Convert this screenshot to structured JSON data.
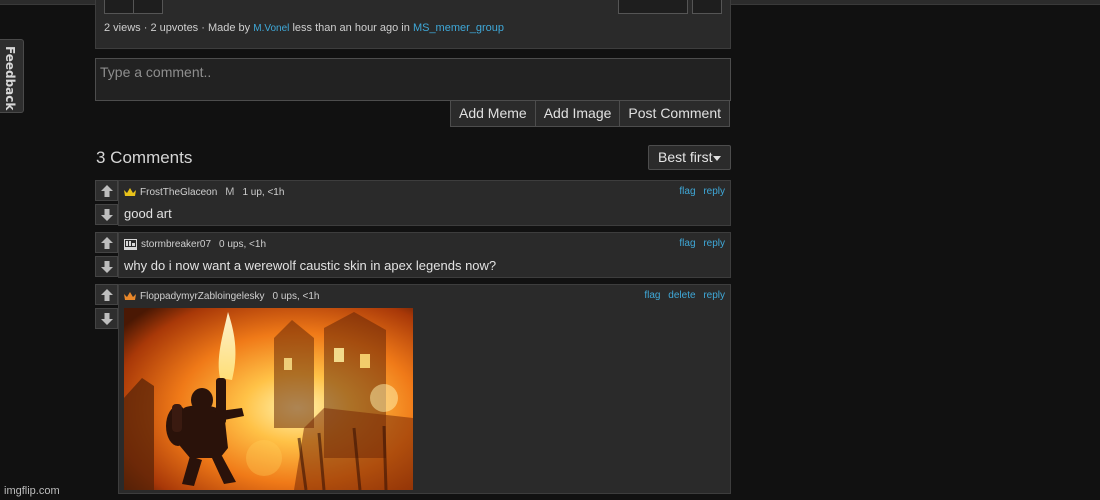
{
  "feedback": {
    "label": "Feedback"
  },
  "meme_meta": {
    "views": "2 views",
    "upvotes": "2 upvotes",
    "separator": "·",
    "made_by_label": "Made by",
    "author": "M.Vonel",
    "time_text": "less than an hour ago in",
    "group": "MS_memer_group"
  },
  "comment_form": {
    "placeholder": "Type a comment..",
    "add_meme_label": "Add Meme",
    "add_image_label": "Add Image",
    "post_comment_label": "Post Comment"
  },
  "comments_header": {
    "count_label": "3 Comments",
    "sort_label": "Best first"
  },
  "comments": [
    {
      "username": "FrostTheGlaceon",
      "mod_badge": "M",
      "stats": "1 up, <1h",
      "text": "good art",
      "actions": {
        "flag": "flag",
        "reply": "reply"
      },
      "icon": "crown-icon",
      "icon_color": "#e8c21a"
    },
    {
      "username": "stormbreaker07",
      "stats": "0 ups, <1h",
      "text": "why do i now want a werewolf caustic skin in apex legends now?",
      "actions": {
        "flag": "flag",
        "reply": "reply"
      },
      "icon": "flag-badge-icon",
      "icon_color": "#d8d8d8"
    },
    {
      "username": "FloppadymyrZabloingelesky",
      "stats": "0 ups, <1h",
      "image": "pyro-burning-building-image",
      "actions": {
        "flag": "flag",
        "delete": "delete",
        "reply": "reply"
      },
      "icon": "crown-icon",
      "icon_color": "#e8872a"
    }
  ],
  "watermark": "imgflip.com",
  "colors": {
    "background": "#111111",
    "panel": "#2a2a2a",
    "link": "#3fa8d8",
    "button": "#2b2b2b"
  }
}
